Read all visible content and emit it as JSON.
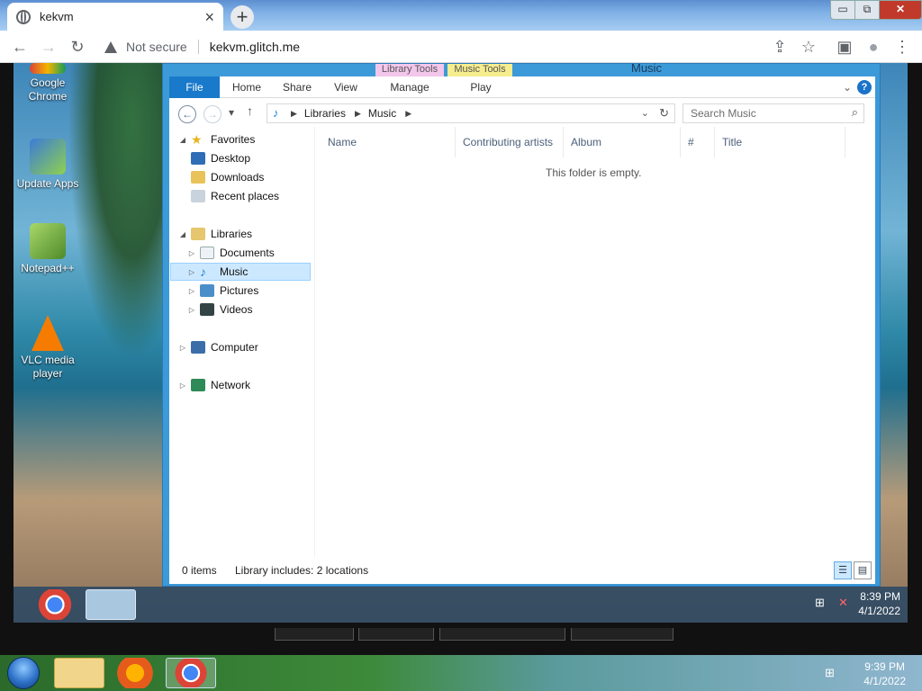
{
  "browser": {
    "tab_title": "kekvm",
    "tab_close": "×",
    "new_tab": "+",
    "security_label": "Not secure",
    "url": "kekvm.glitch.me",
    "win_min": "▭",
    "win_max": "⧉",
    "win_close": "✕",
    "back": "←",
    "forward": "→",
    "reload": "↻",
    "share": "⇪",
    "bookmark": "☆",
    "sidebar": "▣",
    "profile": "●",
    "menu": "⋮"
  },
  "desktop": {
    "icons": [
      {
        "label": "Google Chrome"
      },
      {
        "label": "Update Apps"
      },
      {
        "label": "Notepad++"
      },
      {
        "label": "VLC media player"
      }
    ]
  },
  "explorer": {
    "window_title": "Music",
    "context_tabs": [
      "Library Tools",
      "Music Tools"
    ],
    "ribbon_tabs": [
      "File",
      "Home",
      "Share",
      "View",
      "Manage",
      "Play"
    ],
    "help": "?",
    "breadcrumb": [
      "Libraries",
      "Music"
    ],
    "search_placeholder": "Search Music",
    "nav": {
      "favorites": "Favorites",
      "favorites_items": [
        "Desktop",
        "Downloads",
        "Recent places"
      ],
      "libraries": "Libraries",
      "libraries_items": [
        "Documents",
        "Music",
        "Pictures",
        "Videos"
      ],
      "computer": "Computer",
      "network": "Network"
    },
    "columns": [
      "Name",
      "Contributing artists",
      "Album",
      "#",
      "Title"
    ],
    "empty_message": "This folder is empty.",
    "status_items": "0 items",
    "status_library": "Library includes: 2 locations"
  },
  "inner_taskbar": {
    "time": "8:39 PM",
    "date": "4/1/2022"
  },
  "host_taskbar": {
    "time": "9:39 PM",
    "date": "4/1/2022"
  },
  "colors": {
    "explorer_frame": "#3c9ad8",
    "file_tab": "#1979ca",
    "selection": "#cce8ff"
  }
}
